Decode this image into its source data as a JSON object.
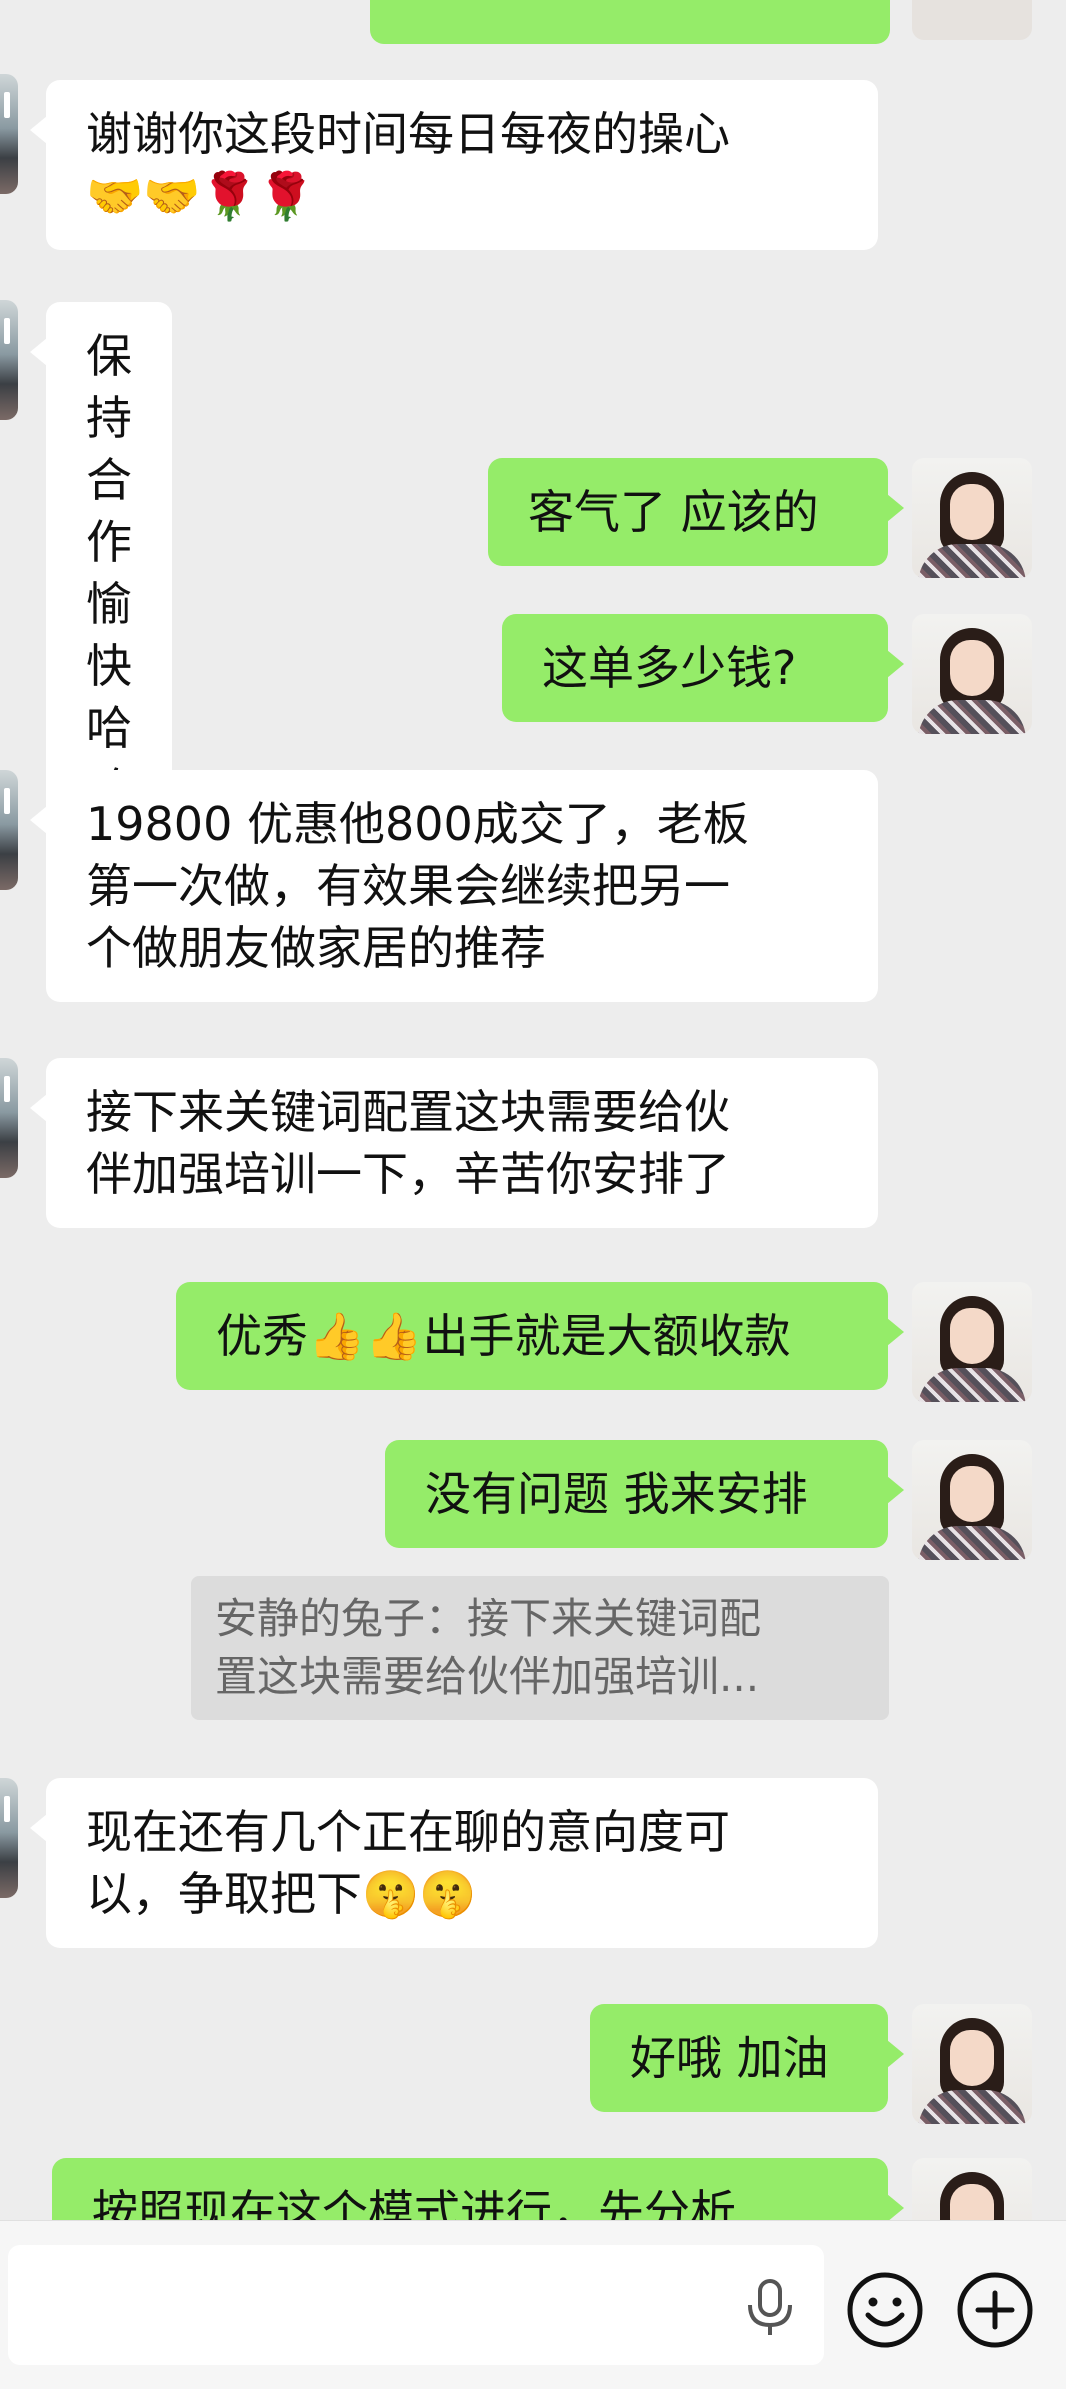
{
  "messages": [
    {
      "side": "in",
      "lines": "谢谢你这段时间每日每夜的操心\n🤝🤝🌹🌹"
    },
    {
      "side": "in",
      "lines": "保持合作愉快 哈哈"
    },
    {
      "side": "out",
      "lines": "客气了 应该的"
    },
    {
      "side": "out",
      "lines": "这单多少钱?"
    },
    {
      "side": "in",
      "lines": "19800 优惠他800成交了，老板\n第一次做，有效果会继续把另一\n个做朋友做家居的推荐"
    },
    {
      "side": "in",
      "lines": "接下来关键词配置这块需要给伙\n伴加强培训一下，辛苦你安排了"
    },
    {
      "side": "out",
      "lines": "优秀👍👍出手就是大额收款"
    },
    {
      "side": "out",
      "lines": "没有问题 我来安排"
    },
    {
      "side": "in",
      "lines": "现在还有几个正在聊的意向度可\n以，争取把下🤫🤫"
    },
    {
      "side": "out",
      "lines": "好哦 加油"
    },
    {
      "side": "out",
      "lines": "按照现在这个模式进行，先分析"
    }
  ],
  "quote": {
    "text": "安静的兔子：接下来关键词配\n置这块需要给伙伴加强培训..."
  },
  "input_bar": {
    "placeholder": "",
    "voice_icon": "microphone-icon",
    "emoji_icon": "smiley-icon",
    "more_icon": "plus-circle-icon"
  },
  "colors": {
    "background": "#ededed",
    "incoming_bubble": "#ffffff",
    "outgoing_bubble": "#95ec69"
  }
}
